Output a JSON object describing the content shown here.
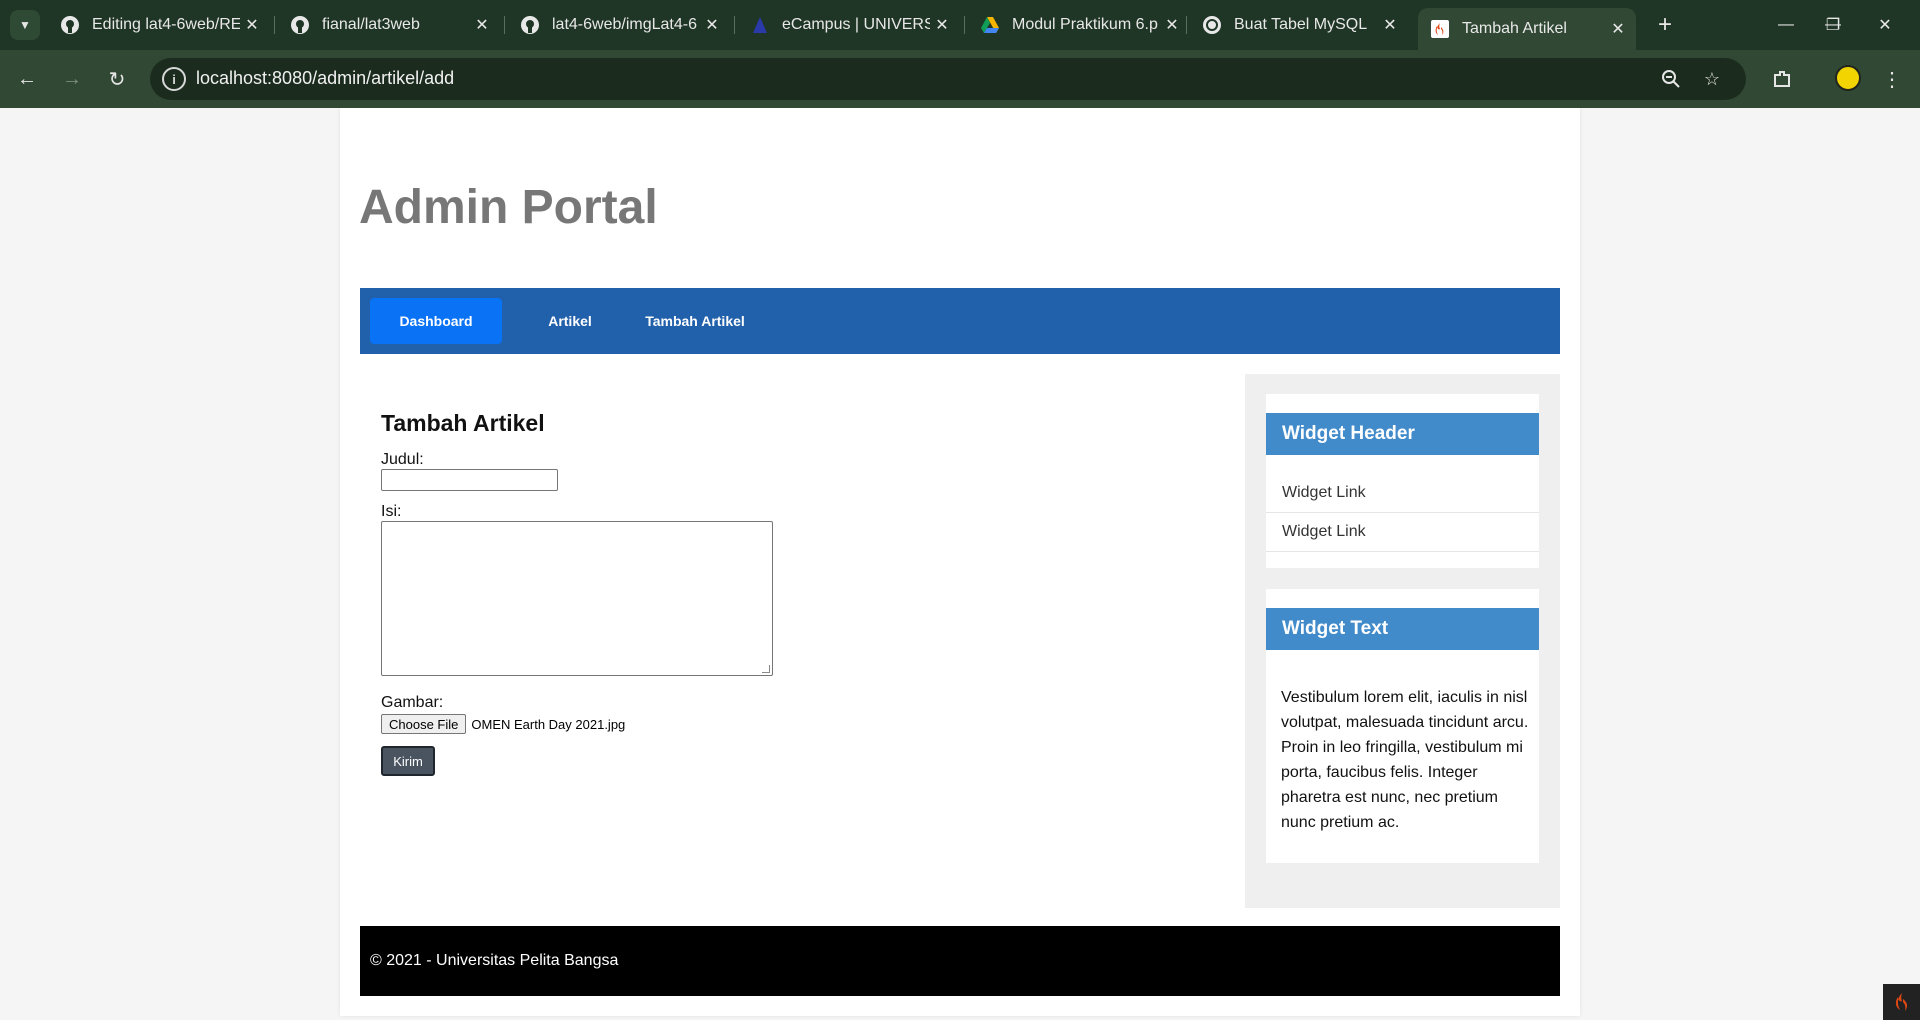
{
  "browser": {
    "tabs": [
      {
        "title": "Editing lat4-6web/RE",
        "icon": "github-icon"
      },
      {
        "title": "fianal/lat3web",
        "icon": "github-icon"
      },
      {
        "title": "lat4-6web/imgLat4-6",
        "icon": "github-icon"
      },
      {
        "title": "eCampus | UNIVERSI",
        "icon": "ecampus-icon"
      },
      {
        "title": "Modul Praktikum 6.p",
        "icon": "google-drive-icon"
      },
      {
        "title": "Buat Tabel MySQL",
        "icon": "chatgpt-icon"
      },
      {
        "title": "Tambah Artikel",
        "icon": "codeigniter-icon"
      }
    ],
    "active_tab_index": 6,
    "url": "localhost:8080/admin/artikel/add"
  },
  "page": {
    "site_title": "Admin Portal",
    "nav": [
      {
        "label": "Dashboard",
        "active": true
      },
      {
        "label": "Artikel",
        "active": false
      },
      {
        "label": "Tambah Artikel",
        "active": false
      }
    ],
    "form": {
      "heading": "Tambah Artikel",
      "judul_label": "Judul:",
      "judul_value": "",
      "isi_label": "Isi:",
      "isi_value": "",
      "gambar_label": "Gambar:",
      "choose_file_label": "Choose File",
      "file_name": "OMEN Earth Day 2021.jpg",
      "submit_label": "Kirim"
    },
    "sidebar": {
      "widget1_header": "Widget Header",
      "widget1_links": [
        "Widget Link",
        "Widget Link"
      ],
      "widget2_header": "Widget Text",
      "widget2_text": "Vestibulum lorem elit, iaculis in nisl volutpat, malesuada tincidunt arcu. Proin in leo fringilla, vestibulum mi porta, faucibus felis. Integer pharetra est nunc, nec pretium nunc pretium ac."
    },
    "footer_text": "© 2021 - Universitas Pelita Bangsa"
  },
  "colors": {
    "nav_background": "#2160aa",
    "nav_active": "#0a72f5",
    "widget_header": "#428bca",
    "footer_background": "#000000",
    "browser_frame": "#304834"
  }
}
